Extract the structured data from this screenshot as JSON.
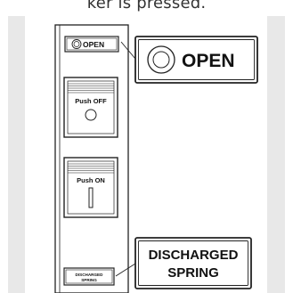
{
  "caption": "ker is pressed.",
  "panel": {
    "open_indicator_label": "OPEN",
    "push_off_label": "Push OFF",
    "push_on_label": "Push ON",
    "discharged_label_line1": "DISCHARGED",
    "discharged_label_line2": "SPRING"
  },
  "callouts": {
    "open_label": "OPEN",
    "discharged_line1": "DISCHARGED",
    "discharged_line2": "SPRING"
  }
}
